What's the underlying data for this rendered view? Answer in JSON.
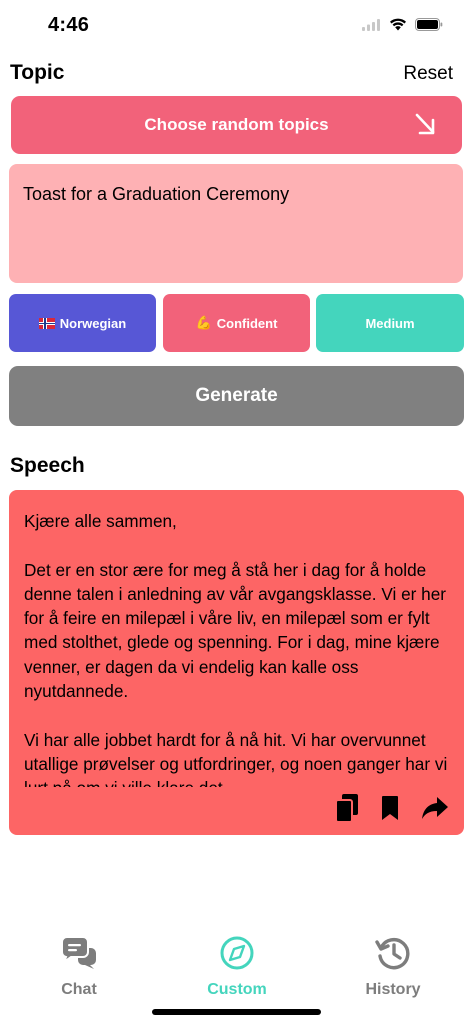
{
  "status_bar": {
    "time": "4:46"
  },
  "topic_section": {
    "title": "Topic",
    "reset_label": "Reset",
    "random_button_label": "Choose random topics",
    "topic_text": "Toast for a Graduation Ceremony"
  },
  "options": {
    "language": "Norwegian",
    "tone": "Confident",
    "length": "Medium"
  },
  "generate_label": "Generate",
  "speech_section": {
    "title": "Speech",
    "text": "Kjære alle sammen,\n\nDet er en stor ære for meg å stå her i dag for å holde denne talen i anledning av vår avgangsklasse. Vi er her for å feire en milepæl i våre liv, en milepæl som er fylt med stolthet, glede og spenning. For i dag, mine kjære venner, er dagen da vi endelig kan kalle oss nyutdannede.\n\nVi har alle jobbet hardt for å nå hit. Vi har overvunnet utallige prøvelser og utfordringer, og noen ganger har vi lurt på om vi ville klare det."
  },
  "tab_bar": {
    "items": [
      {
        "label": "Chat",
        "icon": "chat-bubbles-icon",
        "active": false
      },
      {
        "label": "Custom",
        "icon": "compass-icon",
        "active": true
      },
      {
        "label": "History",
        "icon": "history-clock-icon",
        "active": false
      }
    ]
  },
  "colors": {
    "random_button": "#f2627a",
    "topic_box": "#feb1b4",
    "language_button": "#5757d6",
    "tone_button": "#f2627a",
    "length_button": "#44d5bd",
    "generate_button": "#808080",
    "speech_box": "#fd6565",
    "tab_active": "#44d5bd",
    "tab_inactive": "#7d7d7d"
  }
}
